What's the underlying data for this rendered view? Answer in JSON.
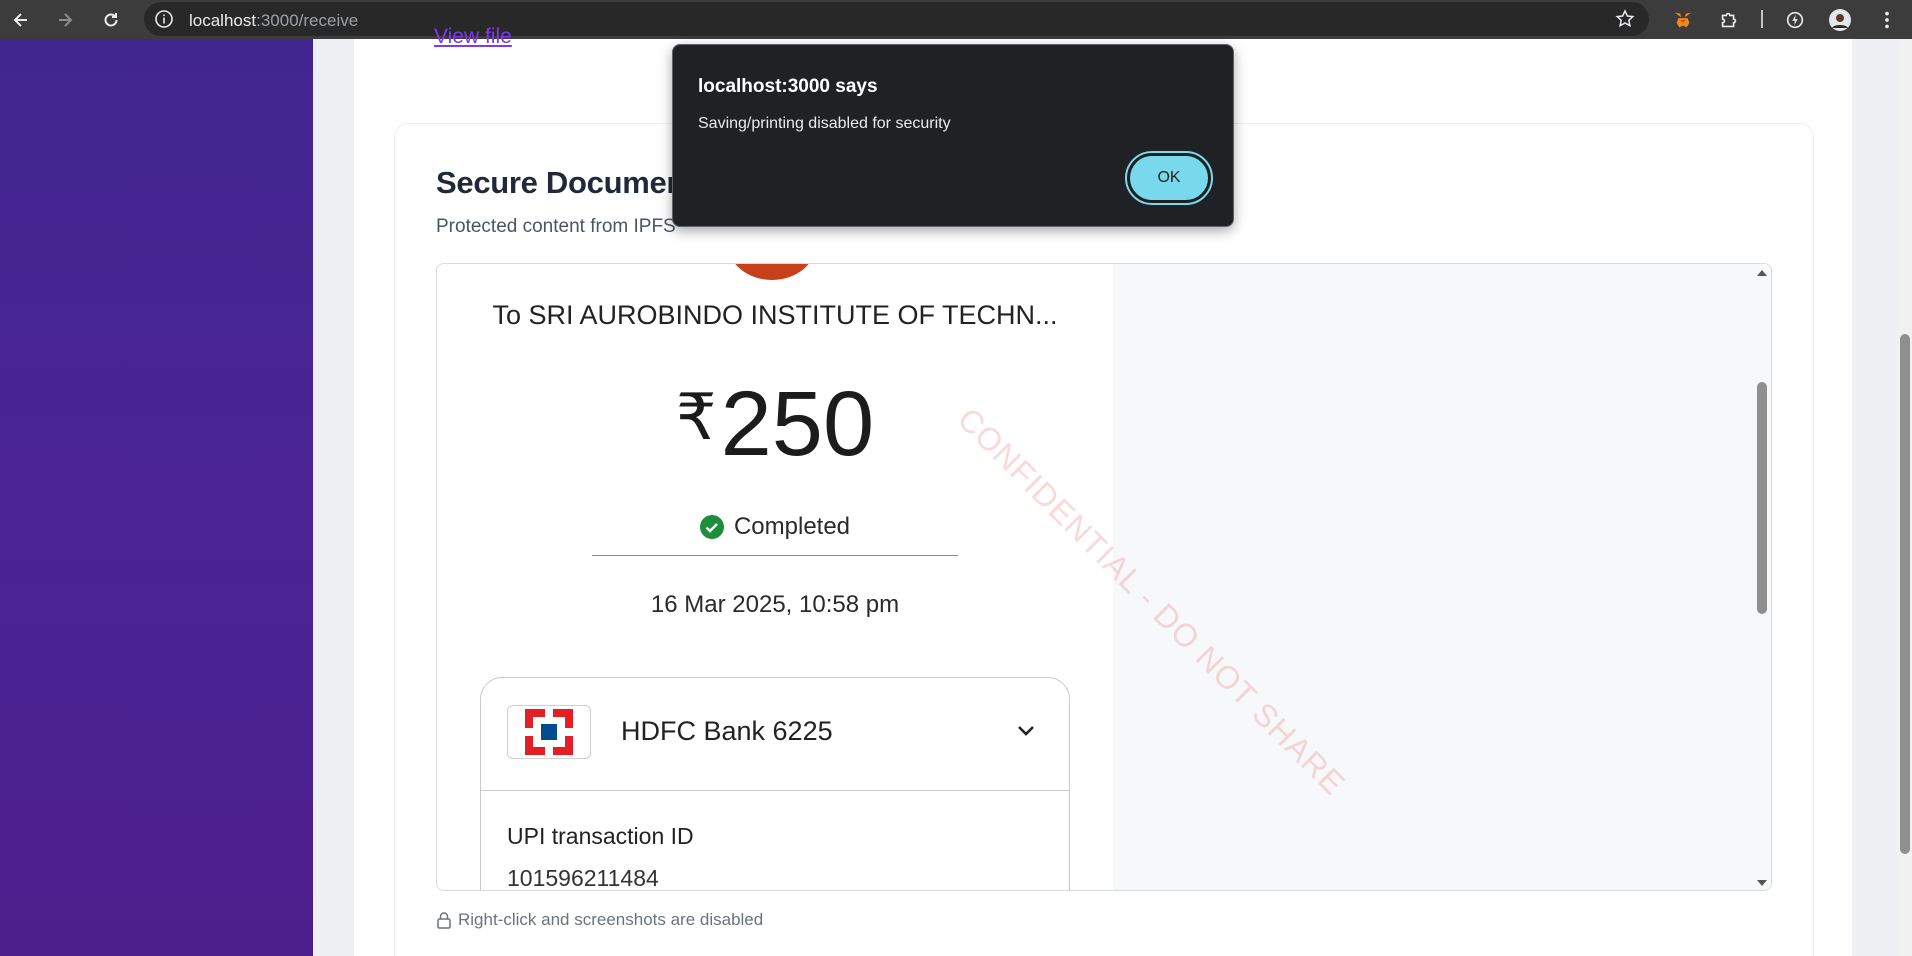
{
  "browser": {
    "url_host": "localhost",
    "url_path": ":3000/receive"
  },
  "page": {
    "view_file_label": "View file",
    "title": "Secure Document",
    "subtitle": "Protected content from IPFS",
    "document": {
      "payee": "To SRI AUROBINDO INSTITUTE OF TECHN...",
      "currency_symbol": "₹",
      "amount": "250",
      "status": "Completed",
      "datetime": "16 Mar 2025, 10:58 pm",
      "bank_name": "HDFC Bank 6225",
      "upi_label": "UPI transaction ID",
      "upi_id": "101596211484"
    },
    "watermark": "CONFIDENTIAL - DO NOT SHARE",
    "note": "Right-click and screenshots are disabled"
  },
  "dialog": {
    "title": "localhost:3000 says",
    "message": "Saving/printing disabled for security",
    "ok_label": "OK"
  },
  "colors": {
    "sidebar": "#4a2494",
    "accent": "#7c3aed",
    "ok_button": "#78d9ec",
    "success": "#1e8e3e",
    "hdfc_red": "#e31e24",
    "hdfc_blue": "#004c8f"
  }
}
